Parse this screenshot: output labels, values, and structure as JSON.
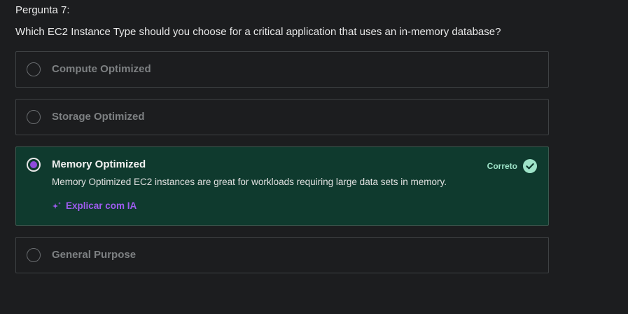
{
  "question": {
    "number_label": "Pergunta 7:",
    "text": "Which EC2 Instance Type should you choose for a critical application that uses an in-memory database?"
  },
  "options": [
    {
      "label": "Compute Optimized",
      "selected": false
    },
    {
      "label": "Storage Optimized",
      "selected": false
    },
    {
      "label": "Memory Optimized",
      "selected": true,
      "status": "Correto",
      "explanation": "Memory Optimized EC2 instances are great for workloads requiring large data sets in memory.",
      "explain_ai_label": "Explicar com IA"
    },
    {
      "label": "General Purpose",
      "selected": false
    }
  ],
  "colors": {
    "background": "#1c1d1f",
    "correct_bg": "#0f3a2e",
    "accent_purple": "#9f5cf0",
    "correct_green": "#9ee3c8"
  },
  "icons": {
    "correct": "check-circle-icon",
    "explain_ai": "sparkle-icon"
  }
}
